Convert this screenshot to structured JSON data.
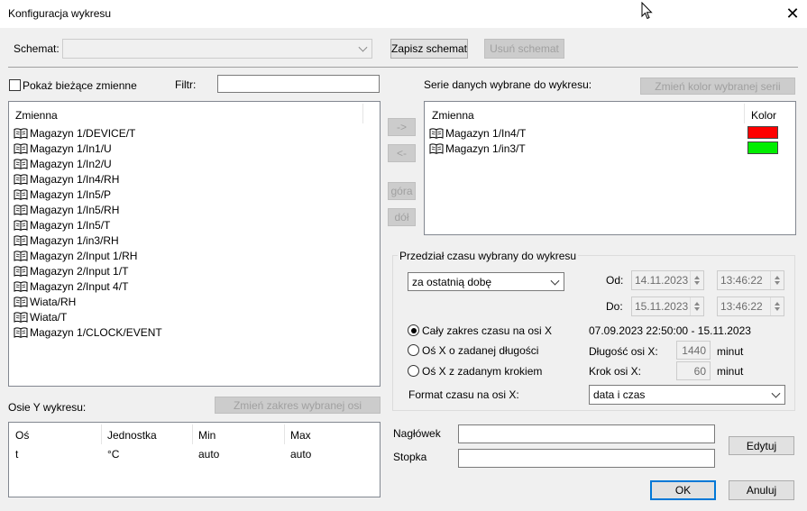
{
  "window": {
    "title": "Konfiguracja wykresu"
  },
  "schema": {
    "label": "Schemat:",
    "value": "",
    "save_button": "Zapisz schemat",
    "delete_button": "Usuń schemat"
  },
  "filter": {
    "show_current_label": "Pokaż bieżące zmienne",
    "filter_label": "Filtr:",
    "filter_value": ""
  },
  "variables": {
    "column_header": "Zmienna",
    "items": [
      "Magazyn 1/DEVICE/T",
      "Magazyn 1/In1/U",
      "Magazyn 1/In2/U",
      "Magazyn 1/In4/RH",
      "Magazyn 1/In5/P",
      "Magazyn 1/In5/RH",
      "Magazyn 1/In5/T",
      "Magazyn 1/in3/RH",
      "Magazyn 2/Input 1/RH",
      "Magazyn 2/Input 1/T",
      "Magazyn 2/Input 4/T",
      "Wiata/RH",
      "Wiata/T",
      "Magazyn 1/CLOCK/EVENT"
    ]
  },
  "transfer": {
    "add": "->",
    "remove": "<-",
    "up": "góra",
    "down": "dół"
  },
  "selected_series": {
    "label": "Serie danych wybrane do wykresu:",
    "change_color_button": "Zmień kolor wybranej serii",
    "col_variable": "Zmienna",
    "col_color": "Kolor",
    "items": [
      {
        "name": "Magazyn 1/In4/T",
        "color": "#ff0000"
      },
      {
        "name": "Magazyn 1/in3/T",
        "color": "#00ee00"
      }
    ]
  },
  "time_range": {
    "group_label": "Przedział czasu wybrany do wykresu",
    "preset": "za ostatnią dobę",
    "from_label": "Od:",
    "to_label": "Do:",
    "from_date": "14.11.2023",
    "from_time": "13:46:22",
    "to_date": "15.11.2023",
    "to_time": "13:46:22",
    "options": [
      {
        "label": "Cały zakres czasu na osi  X",
        "checked": true
      },
      {
        "label": "Oś X o zadanej długości",
        "checked": false
      },
      {
        "label": "Oś X z zadanym krokiem",
        "checked": false
      }
    ],
    "full_range": "07.09.2023 22:50:00 - 15.11.2023",
    "axis_length_label": "Długość osi X:",
    "axis_length_value": "1440",
    "axis_length_unit": "minut",
    "axis_step_label": "Krok osi X:",
    "axis_step_value": "60",
    "axis_step_unit": "minut",
    "format_label": "Format czasu na osi X:",
    "format_value": "data i czas"
  },
  "y_axes": {
    "label": "Osie Y wykresu:",
    "change_range_button": "Zmień zakres wybranej osi",
    "columns": [
      "Oś",
      "Jednostka",
      "Min",
      "Max"
    ],
    "rows": [
      [
        "t",
        "°C",
        "auto",
        "auto"
      ]
    ]
  },
  "footer": {
    "header_label": "Nagłówek",
    "header_value": "",
    "footer_label": "Stopka",
    "footer_value": "",
    "edit_button": "Edytuj",
    "ok_button": "OK",
    "cancel_button": "Anuluj"
  }
}
